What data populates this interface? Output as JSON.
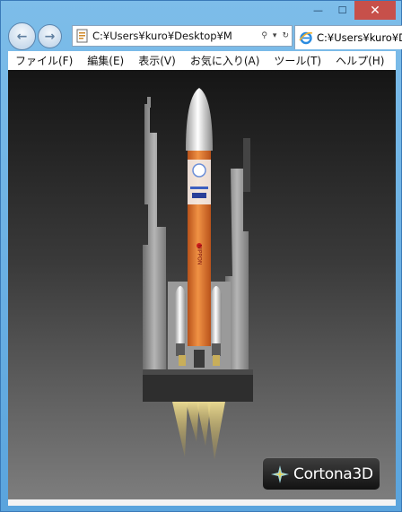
{
  "window": {
    "caption": {
      "minimize_glyph": "—",
      "maximize_glyph": "☐",
      "close_glyph": "✕"
    }
  },
  "navigation": {
    "back_glyph": "←",
    "forward_glyph": "→",
    "address": "C:¥Users¥kuro¥Desktop¥M",
    "tab_title": "C:¥Users¥kuro¥D"
  },
  "menu": {
    "items": [
      "ファイル(F)",
      "編集(E)",
      "表示(V)",
      "お気に入り(A)",
      "ツール(T)",
      "ヘルプ(H)"
    ]
  },
  "scene": {
    "rocket_labels": [
      "NIPPON"
    ],
    "badge_text": "Cortona3D",
    "colors": {
      "rocket_body": "#e9782e",
      "nose_cone": "#f2f2f2",
      "tower": "#8f8f8f",
      "pad": "#2e2e2e",
      "exhaust": "#e8d36a"
    }
  }
}
